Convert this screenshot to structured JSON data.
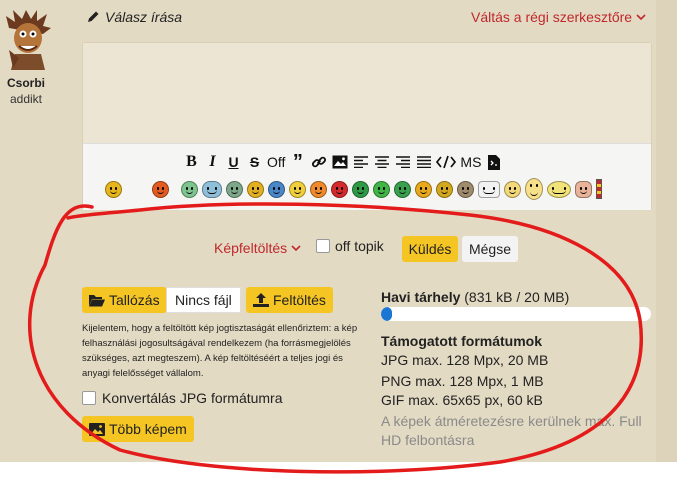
{
  "user": {
    "name": "Csorbi",
    "rank": "addikt"
  },
  "header": {
    "title": "Válasz írása",
    "switch_label": "Váltás a régi szerkesztőre"
  },
  "toolbar": {
    "off_label": "Off",
    "ms_label": "MS",
    "buttons": [
      "bold-icon",
      "italic-icon",
      "underline-icon",
      "strikethrough-icon",
      "off",
      "quote-icon",
      "link-icon",
      "image-icon",
      "align-left-icon",
      "align-center-icon",
      "align-right-icon",
      "justify-icon",
      "code-icon",
      "ms",
      "spoiler-icon"
    ]
  },
  "smileys": {
    "colors": [
      "#e6b61c",
      "#ffffff",
      "#e35b21",
      "#7ec48f",
      "#8fbfd9",
      "#7ea88a",
      "#e5b020",
      "#4a87c9",
      "#f0cf3c",
      "#f08a2c",
      "#d32b2b",
      "#2e9a45",
      "#41b646",
      "#3aa04e",
      "#e8a91d",
      "#d4a81e",
      "#a08b6d"
    ]
  },
  "upload_bar": {
    "image_upload_label": "Képfeltöltés",
    "offtopic_label": "off topik",
    "send_label": "Küldés",
    "cancel_label": "Mégse"
  },
  "uploader": {
    "browse_label": "Tallózás",
    "nofile_label": "Nincs fájl",
    "upload_label": "Feltöltés",
    "legal_text": "Kijelentem, hogy a feltöltött kép jogtisztaságát ellenőriztem: a kép felhasználási jogosultságával rendelkezem (ha forrásmegjelölés szükséges, azt megteszem). A kép feltöltéséért a teljes jogi és anyagi felelősséget vállalom.",
    "convert_label": "Konvertálás JPG formátumra",
    "more_label": "Több képem"
  },
  "storage": {
    "title": "Havi tárhely",
    "usage": "(831 kB / 20 MB)",
    "used_fraction": 0.04,
    "bar_color": "#1976d2"
  },
  "formats": {
    "title": "Támogatott formátumok",
    "jpg": "JPG max. 128 Mpx, 20 MB",
    "png": "PNG max. 128 Mpx, 1 MB",
    "gif": "GIF max. 65x65 px, 60 kB",
    "note": "A képek átméretezésre kerülnek max. Full HD felbontásra"
  },
  "colors": {
    "accent_red": "#c0282d",
    "button_yellow": "#f5c623",
    "page_bg": "#e3dac3",
    "annotation_red": "#e31b1b"
  }
}
